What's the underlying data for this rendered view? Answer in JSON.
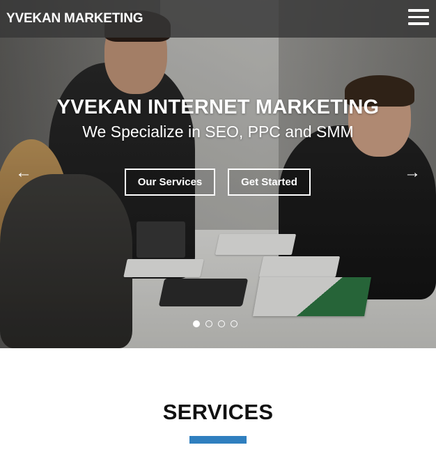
{
  "header": {
    "brand": "YVEKAN MARKETING",
    "menu_icon": "hamburger-menu-icon"
  },
  "hero": {
    "title": "YVEKAN INTERNET MARKETING",
    "subtitle": "We Specialize in SEO, PPC and SMM",
    "buttons": {
      "our_services": "Our Services",
      "get_started": "Get Started"
    },
    "prev_arrow": "←",
    "next_arrow": "→",
    "slides": {
      "count": 4,
      "active_index": 0
    }
  },
  "services": {
    "title": "SERVICES",
    "accent_color": "#2f7fbf"
  }
}
